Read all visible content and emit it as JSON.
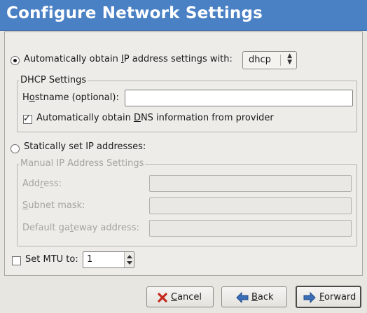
{
  "window": {
    "title": "Configure Network Settings"
  },
  "auto_ip": {
    "label_pre": "Automatically obtain ",
    "label_u": "I",
    "label_post": "P address settings with:",
    "selected": true,
    "method_value": "dhcp"
  },
  "dhcp": {
    "frame_title": "DHCP Settings",
    "hostname_label_pre": "H",
    "hostname_label_u": "o",
    "hostname_label_post": "stname (optional):",
    "hostname_value": "",
    "dns_label_pre": "Automatically obtain ",
    "dns_label_u": "D",
    "dns_label_post": "NS information from provider",
    "dns_checked": true
  },
  "static_ip": {
    "label": "Statically set IP addresses:",
    "selected": false
  },
  "manual": {
    "frame_title": "Manual IP Address Settings",
    "address_label_pre": "Add",
    "address_label_u": "r",
    "address_label_post": "ess:",
    "subnet_label_pre": "",
    "subnet_label_u": "S",
    "subnet_label_post": "ubnet mask:",
    "gateway_label_pre": "Default ga",
    "gateway_label_u": "t",
    "gateway_label_post": "eway address:"
  },
  "mtu": {
    "label": "Set MTU to:",
    "checked": false,
    "value": "1"
  },
  "buttons": {
    "cancel_u": "C",
    "cancel_rest": "ancel",
    "back_u": "B",
    "back_rest": "ack",
    "forward_u": "F",
    "forward_rest": "orward"
  },
  "colors": {
    "title_bar": "#4a80c4",
    "background": "#e8e6e1"
  },
  "icons": {
    "cancel": "red-x-icon",
    "back": "blue-left-arrow-icon",
    "forward": "blue-right-arrow-icon"
  }
}
